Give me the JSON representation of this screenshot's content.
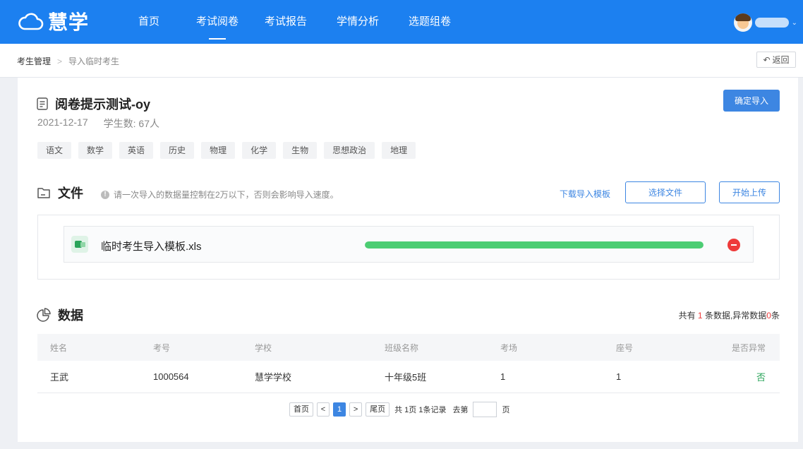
{
  "app": {
    "logo_text": "慧学",
    "brand_color": "#1c80f0",
    "accent_color": "#3d86e2"
  },
  "nav": {
    "items": [
      {
        "label": "首页",
        "active": false
      },
      {
        "label": "考试阅卷",
        "active": true
      },
      {
        "label": "考试报告",
        "active": false
      },
      {
        "label": "学情分析",
        "active": false
      },
      {
        "label": "选题组卷",
        "active": false
      }
    ],
    "user_icon": "avatar-icon",
    "user_menu_icon": "chevron-down-icon"
  },
  "breadcrumb": {
    "root": "考生管理",
    "current": "导入临时考生",
    "back_label": "返回"
  },
  "exam": {
    "title": "阅卷提示测试-oy",
    "date": "2021-12-17",
    "student_count": "学生数: 67人",
    "confirm_label": "确定导入",
    "subjects": [
      "语文",
      "数学",
      "英语",
      "历史",
      "物理",
      "化学",
      "生物",
      "思想政治",
      "地理"
    ]
  },
  "file_section": {
    "title": "文件",
    "hint": "请一次导入的数据量控制在2万以下，否则会影响导入速度。",
    "download_template": "下载导入模板",
    "select_file": "选择文件",
    "start_upload": "开始上传",
    "file": {
      "name": "临时考生导入模板.xls",
      "progress": 1.0,
      "progress_color": "#4ccd73"
    }
  },
  "data_section": {
    "title": "数据",
    "summary_prefix": "共有",
    "total_count": "1",
    "summary_middle": "条数据,异常数据",
    "error_count": "0",
    "summary_suffix": "条",
    "columns": [
      "姓名",
      "考号",
      "学校",
      "班级名称",
      "考场",
      "座号",
      "是否异常"
    ],
    "rows": [
      [
        "王武",
        "1000564",
        "慧学学校",
        "十年级5班",
        "1",
        "1",
        "否"
      ]
    ]
  },
  "pagination": {
    "first": "首页",
    "prev": "<",
    "current": "1",
    "next": ">",
    "last": "尾页",
    "info": "共 1页 1条记录",
    "goto_label": "去第",
    "page_suffix": "页",
    "goto_value": ""
  }
}
